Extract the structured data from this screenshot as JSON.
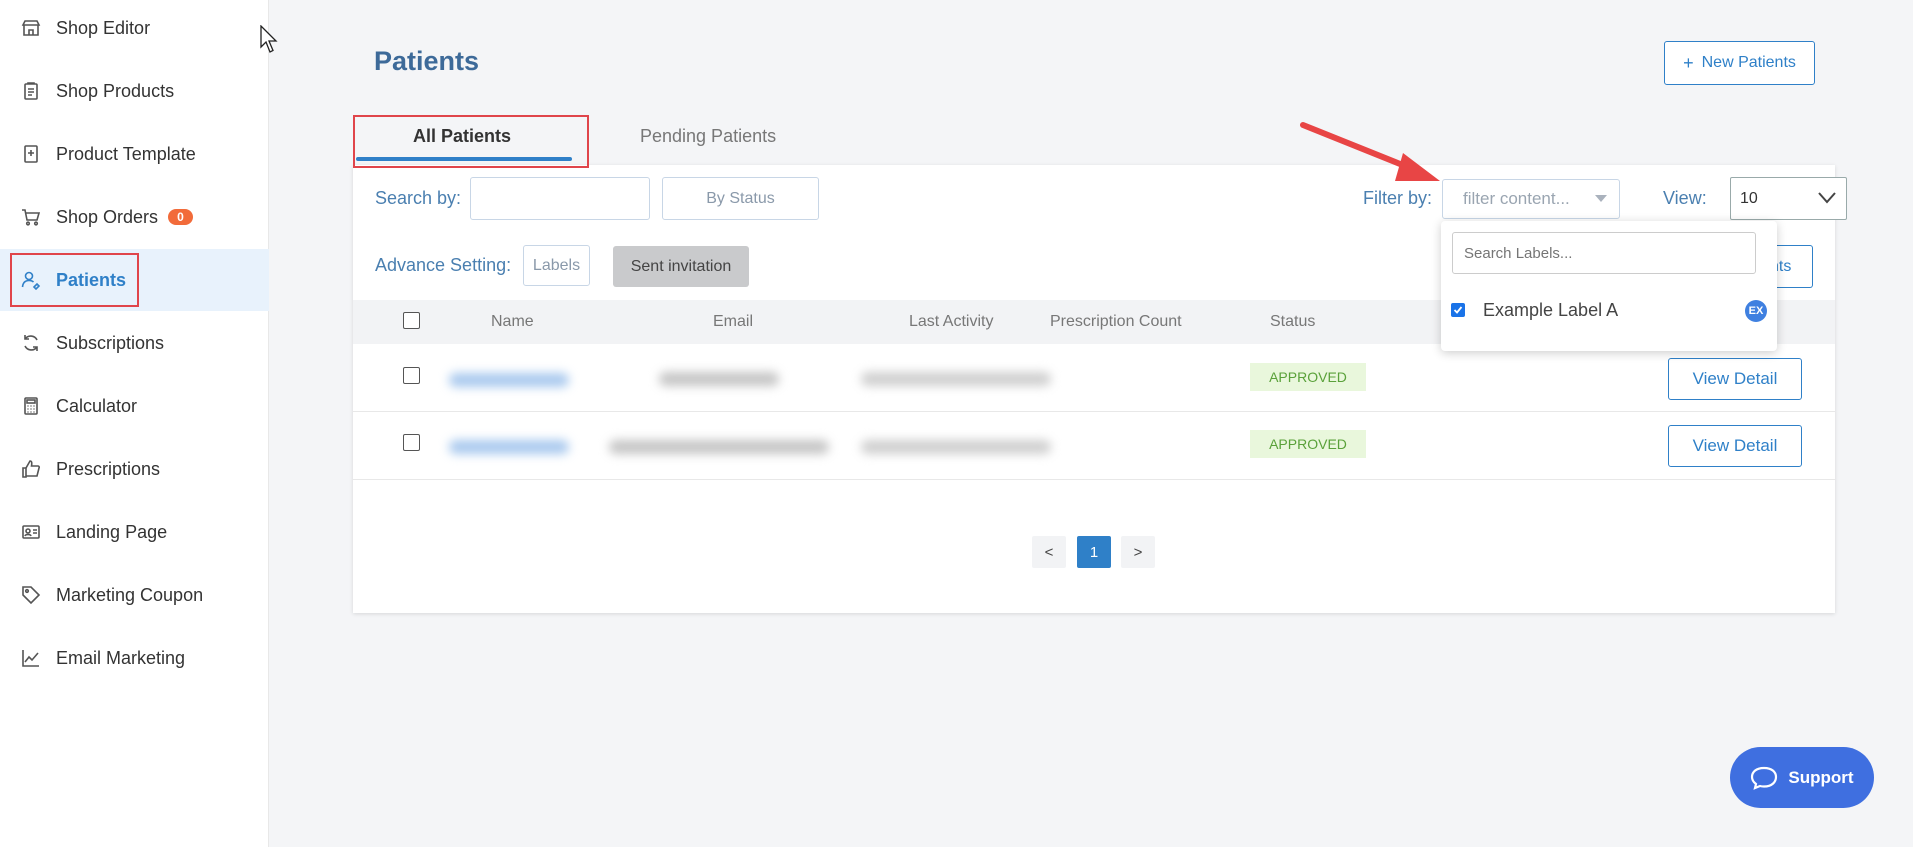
{
  "sidebar": {
    "items": [
      {
        "label": "Shop Editor",
        "icon": "shop-icon"
      },
      {
        "label": "Shop Products",
        "icon": "clipboard-icon"
      },
      {
        "label": "Product Template",
        "icon": "template-icon"
      },
      {
        "label": "Shop Orders",
        "icon": "cart-icon",
        "badge": "0"
      },
      {
        "label": "Patients",
        "icon": "user-icon",
        "active": true
      },
      {
        "label": "Subscriptions",
        "icon": "refresh-icon"
      },
      {
        "label": "Calculator",
        "icon": "calculator-icon"
      },
      {
        "label": "Prescriptions",
        "icon": "thumbs-up-icon"
      },
      {
        "label": "Landing Page",
        "icon": "id-card-icon"
      },
      {
        "label": "Marketing Coupon",
        "icon": "tag-icon"
      },
      {
        "label": "Email Marketing",
        "icon": "chart-icon"
      }
    ]
  },
  "page": {
    "title": "Patients",
    "new_button": "New Patients",
    "new_button_icon": "+"
  },
  "tabs": [
    {
      "label": "All Patients",
      "active": true
    },
    {
      "label": "Pending Patients",
      "active": false
    }
  ],
  "filters": {
    "search_label": "Search by:",
    "search_value": "",
    "status_button": "By Status",
    "filter_label": "Filter by:",
    "filter_placeholder": "filter content...",
    "view_label": "View:",
    "view_value": "10",
    "advance_label": "Advance Setting:",
    "labels_button": "Labels",
    "sent_invitation_button": "Sent invitation",
    "hidden_button_fragment": "nts"
  },
  "table": {
    "columns": [
      "Name",
      "Email",
      "Last Activity",
      "Prescription Count",
      "Status"
    ],
    "rows": [
      {
        "status": "APPROVED",
        "action": "View Detail"
      },
      {
        "status": "APPROVED",
        "action": "View Detail"
      }
    ]
  },
  "pagination": {
    "prev": "<",
    "current": "1",
    "next": ">"
  },
  "dropdown": {
    "search_placeholder": "Search Labels...",
    "options": [
      {
        "label": "Example Label A",
        "checked": true,
        "badge": "EX"
      }
    ]
  },
  "support": {
    "label": "Support"
  },
  "colors": {
    "accent": "#2f80c8",
    "badge": "#f26b3a",
    "approved_bg": "#e9f7dc",
    "approved_text": "#5aa13a",
    "highlight": "#e0454b",
    "support": "#3f6fe0"
  }
}
